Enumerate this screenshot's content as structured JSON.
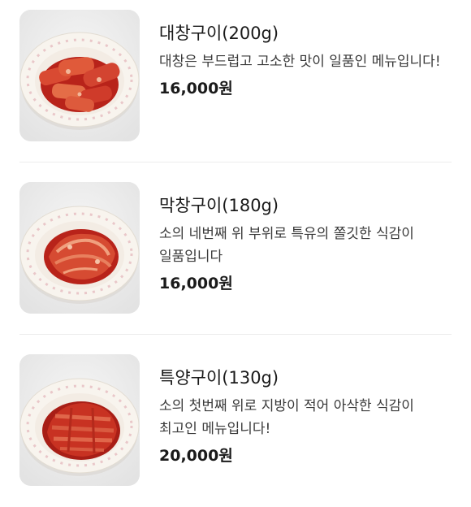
{
  "menu": {
    "items": [
      {
        "image": "daechang-gui-photo",
        "name": "대창구이(200g)",
        "description": "대창은 부드럽고 고소한 맛이 일품인 메뉴입니다!",
        "price": "16,000원"
      },
      {
        "image": "makchang-gui-photo",
        "name": "막창구이(180g)",
        "description": "소의 네번째 위 부위로 특유의 쫄깃한 식감이 일품입니다",
        "price": "16,000원"
      },
      {
        "image": "teukyang-gui-photo",
        "name": "특양구이(130g)",
        "description": "소의 첫번째 위로 지방이 적어 아삭한 식감이 최고인 메뉴입니다!",
        "price": "20,000원"
      }
    ]
  },
  "colors": {
    "background": "#ffffff",
    "divider": "#ececec",
    "dish_sauce": "#c0281c",
    "plate": "#f7f3ee"
  }
}
